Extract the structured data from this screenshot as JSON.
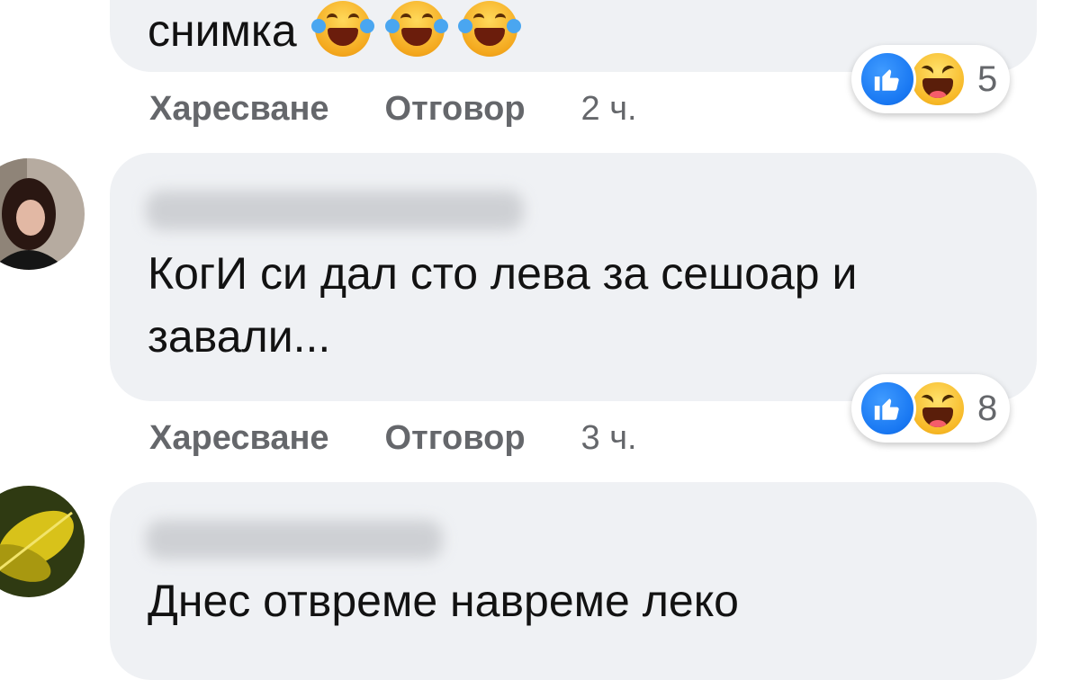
{
  "comments": [
    {
      "text_lines": [
        "снимка"
      ],
      "emoji_names": [
        "tears-of-joy-emoji",
        "tears-of-joy-emoji",
        "tears-of-joy-emoji"
      ],
      "reaction_icons": [
        "like-icon",
        "haha-icon"
      ],
      "reaction_count": "5",
      "like_label": "Харесване",
      "reply_label": "Отговор",
      "time": "2 ч."
    },
    {
      "text_lines": [
        "КогИ си дал сто лева за сешоар и",
        "завали..."
      ],
      "reaction_icons": [
        "like-icon",
        "haha-icon"
      ],
      "reaction_count": "8",
      "like_label": "Харесване",
      "reply_label": "Отговор",
      "time": "3 ч."
    },
    {
      "text_lines": [
        "Днес отвреме навреме леко"
      ]
    }
  ],
  "colors": {
    "bubble": "#eff1f4",
    "meta_text": "#65676b",
    "like_blue": "#1877f2",
    "haha_yellow": "#f7b928"
  }
}
